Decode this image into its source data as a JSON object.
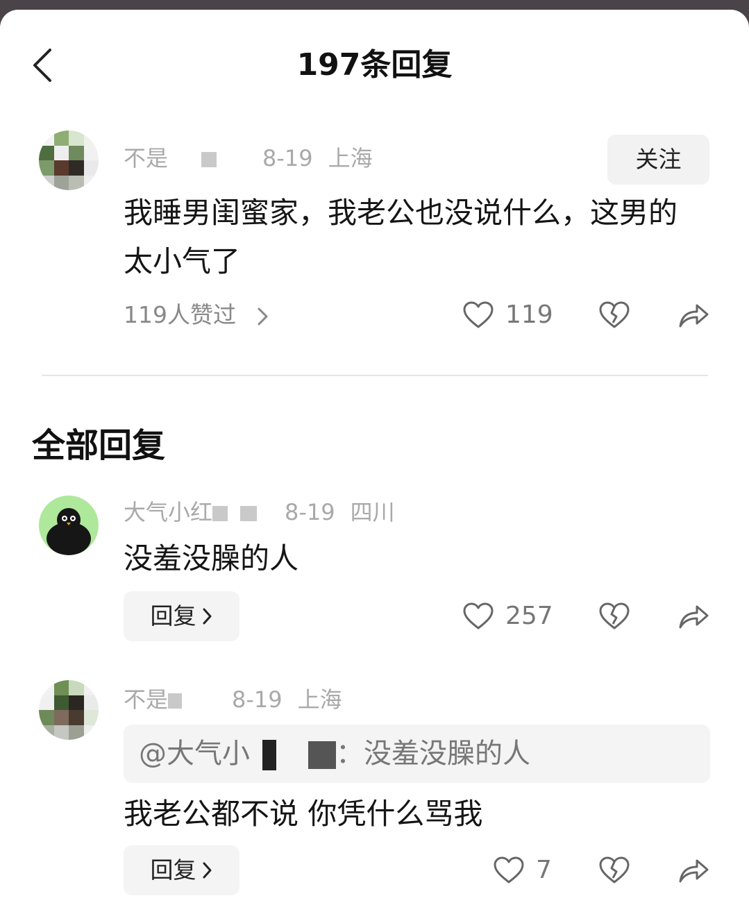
{
  "header": {
    "title": "197条回复"
  },
  "root_comment": {
    "username": "不是",
    "date": "8-19",
    "location": "上海",
    "follow_label": "关注",
    "text": "我睡男闺蜜家，我老公也没说什么，这男的太小气了",
    "likers_label": "119人赞过",
    "like_count": "119"
  },
  "section": {
    "title": "全部回复"
  },
  "replies": [
    {
      "username": "大气小红",
      "date": "8-19",
      "location": "四川",
      "text": "没羞没臊的人",
      "reply_label": "回复",
      "like_count": "257"
    },
    {
      "username": "不是",
      "date": "8-19",
      "location": "上海",
      "quote_user": "@大气小",
      "quote_text": "：没羞没臊的人",
      "text": "我老公都不说 你凭什么骂我",
      "reply_label": "回复",
      "like_count": "7"
    }
  ],
  "icons": {
    "back": "chevron-left-icon",
    "like": "heart-outline-icon",
    "dislike": "broken-heart-icon",
    "share": "share-arrow-icon",
    "more": "chevron-right-icon"
  },
  "colors": {
    "background_dim": "#4a4448",
    "sheet": "#ffffff",
    "muted": "#a9a9a9",
    "button_bg": "#f2f2f2"
  }
}
